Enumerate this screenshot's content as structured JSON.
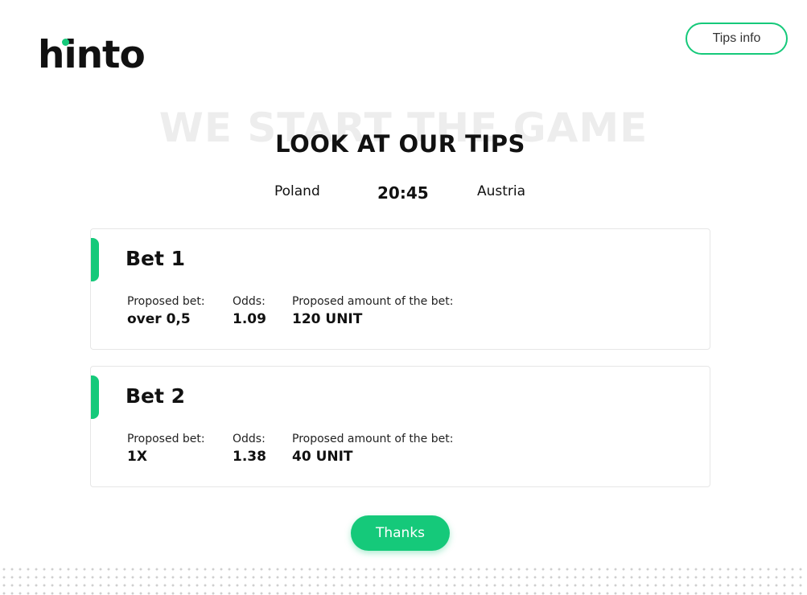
{
  "brand": {
    "logo_text": "hinto",
    "accent_color": "#15c97a"
  },
  "header": {
    "tips_info_label": "Tips info"
  },
  "headline": {
    "background_text": "WE START THE GAME",
    "title": "LOOK AT OUR TIPS"
  },
  "match": {
    "home_team": "Poland",
    "time": "20:45",
    "away_team": "Austria"
  },
  "labels": {
    "proposed_bet": "Proposed bet:",
    "odds": "Odds:",
    "amount": "Proposed amount of the bet:"
  },
  "bets": [
    {
      "title": "Bet 1",
      "proposed_bet": "over 0,5",
      "odds": "1.09",
      "amount": "120 UNIT"
    },
    {
      "title": "Bet 2",
      "proposed_bet": "1X",
      "odds": "1.38",
      "amount": "40 UNIT"
    }
  ],
  "actions": {
    "thanks_label": "Thanks"
  }
}
